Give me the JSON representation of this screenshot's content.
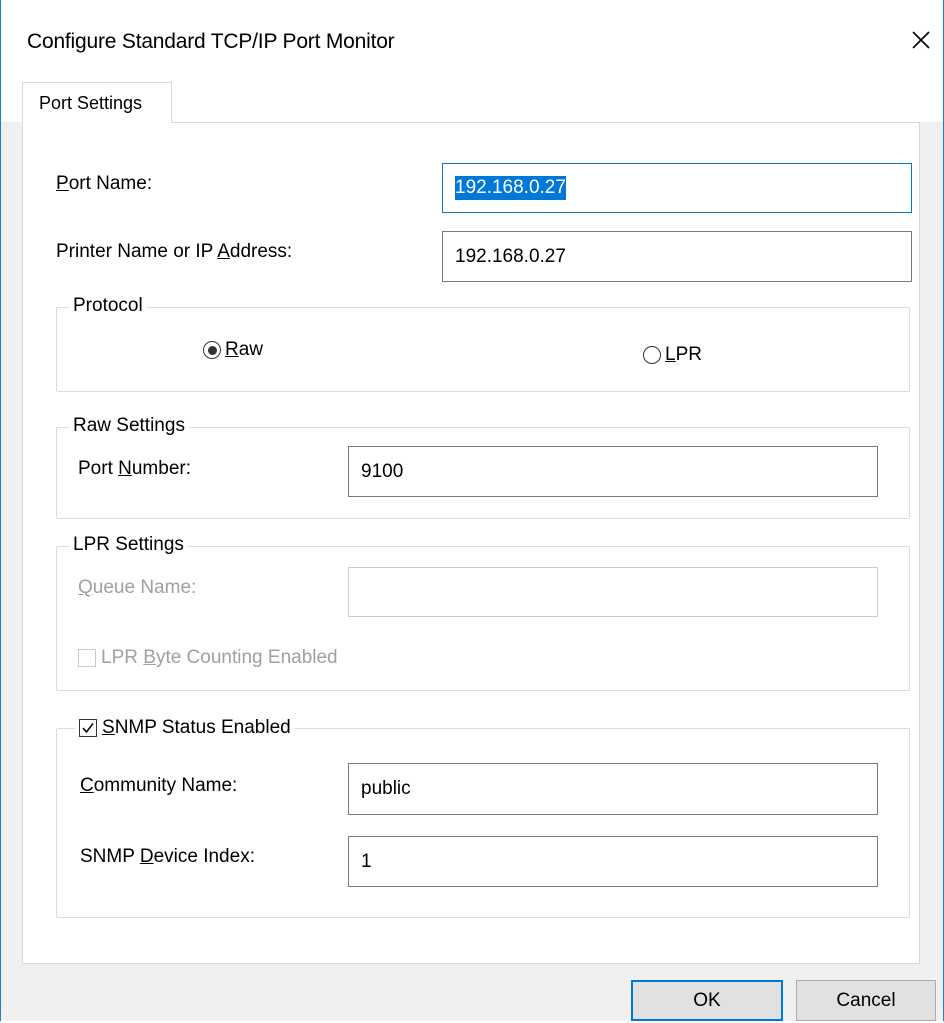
{
  "window": {
    "title": "Configure Standard TCP/IP Port Monitor",
    "close_glyph": "✕"
  },
  "tabs": [
    {
      "label": "Port Settings",
      "selected": true
    }
  ],
  "port_name": {
    "label": "Port Name:",
    "underline_char": "P",
    "value": "192.168.0.27",
    "text_selected": true
  },
  "printer_address": {
    "label": "Printer Name or IP Address:",
    "value": "192.168.0.27"
  },
  "protocol": {
    "title": "Protocol",
    "options": [
      {
        "label": "Raw",
        "checked": true
      },
      {
        "label": "LPR",
        "checked": false
      }
    ]
  },
  "raw_settings": {
    "title": "Raw Settings",
    "port_number_label": "Port Number:",
    "port_number_value": "9100"
  },
  "lpr_settings": {
    "title": "LPR Settings",
    "queue_name_label": "Queue Name:",
    "queue_name_value": "",
    "byte_counting_label": "LPR Byte Counting Enabled",
    "byte_counting_checked": false,
    "enabled": false
  },
  "snmp": {
    "status_label": "SNMP Status Enabled",
    "status_checked": true,
    "community_label": "Community Name:",
    "community_value": "public",
    "device_index_label": "SNMP Device Index:",
    "device_index_value": "1"
  },
  "buttons": {
    "ok": "OK",
    "cancel": "Cancel"
  },
  "colors": {
    "accent": "#0078d7",
    "window_border": "#1883d7",
    "disabled_text": "#a0a0a0"
  }
}
